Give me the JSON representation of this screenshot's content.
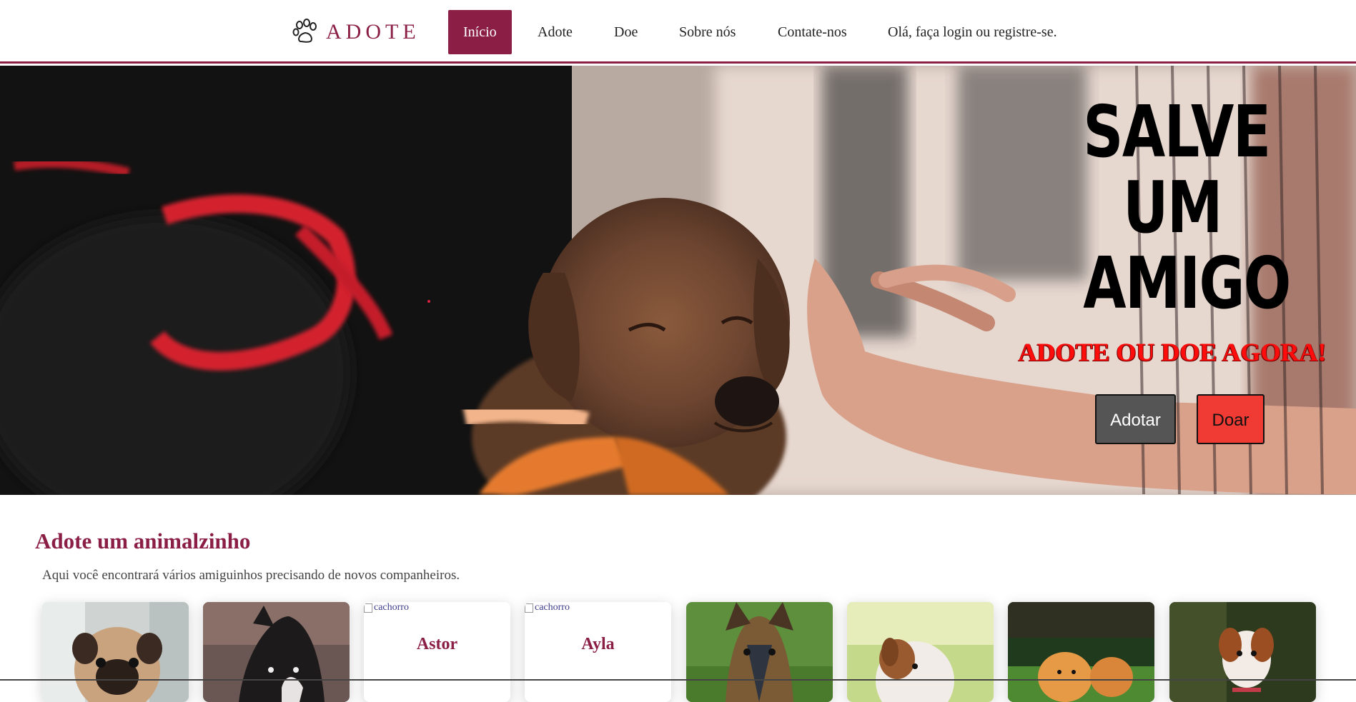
{
  "nav": {
    "logo_text": "ADOTE",
    "logo_icon": "paw-icon",
    "items": [
      {
        "label": "Início",
        "active": true
      },
      {
        "label": "Adote"
      },
      {
        "label": "Doe"
      },
      {
        "label": "Sobre nós"
      },
      {
        "label": "Contate-nos"
      },
      {
        "label": "Olá, faça login ou registre-se."
      }
    ]
  },
  "hero": {
    "title_lines": [
      "SALVE",
      "UM",
      "AMIGO"
    ],
    "subtitle": "ADOTE OU DOE AGORA!",
    "adopt_button": "Adotar",
    "donate_button": "Doar"
  },
  "section": {
    "title": "Adote um animalzinho",
    "description": "Aqui você encontrará vários amiguinhos precisando de novos companheiros.",
    "cards": [
      {
        "kind": "photo",
        "alt": "pug"
      },
      {
        "kind": "photo",
        "alt": "border collie"
      },
      {
        "kind": "broken",
        "alt": "cachorro",
        "name": "Astor"
      },
      {
        "kind": "broken",
        "alt": "cachorro",
        "name": "Ayla"
      },
      {
        "kind": "photo",
        "alt": "yorkshire"
      },
      {
        "kind": "photo",
        "alt": "jack russell puppy"
      },
      {
        "kind": "photo",
        "alt": "pomeranian"
      },
      {
        "kind": "photo",
        "alt": "beagle puppy"
      }
    ]
  },
  "colors": {
    "brand": "#8b1e45",
    "hero_subtitle": "#ff0d0d",
    "adopt_button_bg": "#555555",
    "donate_button_bg": "#ef3b33"
  }
}
